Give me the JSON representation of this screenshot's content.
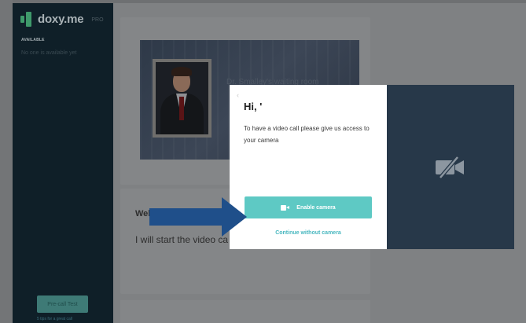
{
  "sidebar": {
    "logo_text": "doxy.me",
    "pro_badge": "PRO",
    "available_label": "AVAILABLE",
    "available_empty": "No one is available yet",
    "precall_button": "Pre-call Test",
    "tips_link": "5 tips for a great call"
  },
  "waiting_room": {
    "title": "Dr. Smalley's waiting room",
    "welcome": "Wel",
    "start_text": "I will start the video ca"
  },
  "modal": {
    "back_glyph": "‹",
    "title": "Hi, '",
    "message": "To have a video call please give us access to your camera",
    "enable_button": "Enable camera",
    "continue_link": "Continue without camera"
  },
  "icons": {
    "enable_button_icon": "video-camera-icon",
    "preview_icon": "video-off-icon"
  },
  "colors": {
    "sidebar_bg": "#0f1f28",
    "brand_green": "#3f9a6b",
    "enable_button": "#5ec9c4",
    "link": "#4ab8c0",
    "preview_bg": "#273849",
    "arrow": "#1f4f8a"
  }
}
